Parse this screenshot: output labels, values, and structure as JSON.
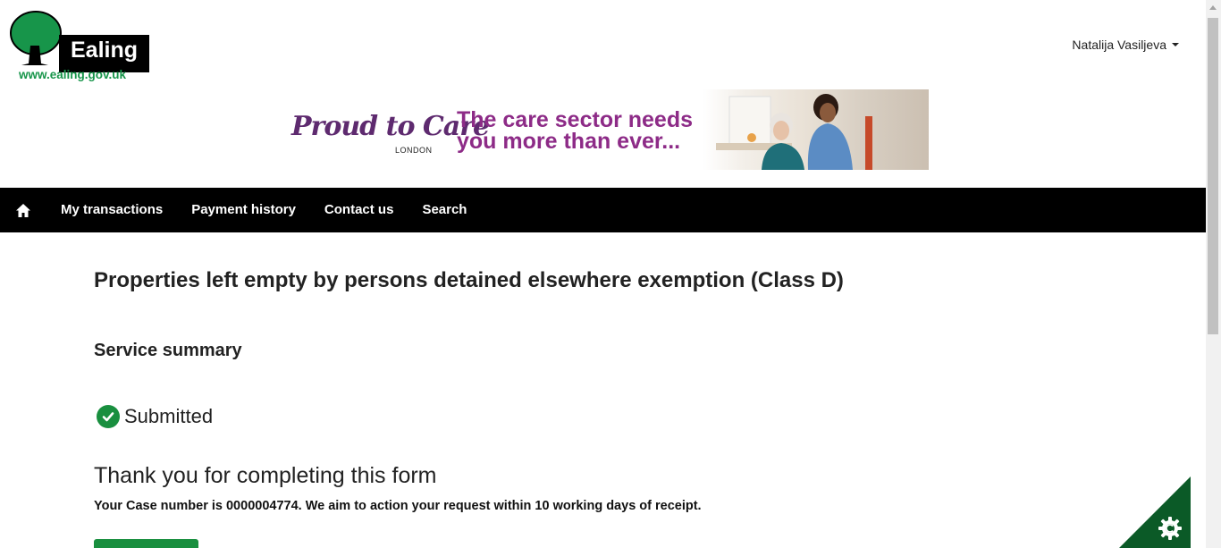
{
  "header": {
    "logo_name": "Ealing",
    "logo_url": "www.ealing.gov.uk",
    "user_name": "Natalija Vasiljeva"
  },
  "banner": {
    "brand": "Proud to Care",
    "brand_sub": "LONDON",
    "headline": "The care sector needs you more than ever..."
  },
  "nav": {
    "items": [
      "My transactions",
      "Payment history",
      "Contact us",
      "Search"
    ]
  },
  "main": {
    "title": "Properties left empty by persons detained elsewhere exemption (Class D)",
    "section_title": "Service summary",
    "status": "Submitted",
    "thanks": "Thank you for completing this form",
    "case_info": "Your Case number is 0000004774. We aim to action your request within 10 working days of receipt."
  },
  "colors": {
    "brand_green": "#198f3f",
    "corner_green": "#0b5a27",
    "nav_bg": "#000000",
    "banner_purple": "#8d2b87"
  },
  "icons": {
    "home": "home-icon",
    "check": "check-circle-icon",
    "settings": "gear-icon",
    "caret": "caret-down-icon"
  }
}
